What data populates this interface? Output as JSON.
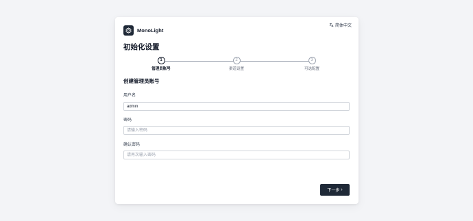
{
  "brand": {
    "name": "MonoLight",
    "logo_icon": "gear-icon"
  },
  "language": {
    "icon": "translate-icon",
    "label": "简体中文"
  },
  "page_title": "初始化设置",
  "steps": [
    {
      "number": "1",
      "label": "管理员账号",
      "active": true
    },
    {
      "number": "2",
      "label": "渠道设置",
      "active": false
    },
    {
      "number": "3",
      "label": "可选配置",
      "active": false
    }
  ],
  "section_title": "创建管理员账号",
  "form": {
    "username": {
      "label": "用户名",
      "value": "admin",
      "placeholder": ""
    },
    "password": {
      "label": "密码",
      "value": "",
      "placeholder": "请输入密码"
    },
    "confirm": {
      "label": "确认密码",
      "value": "",
      "placeholder": "请再次输入密码"
    }
  },
  "next_button": {
    "label": "下一步",
    "icon": "chevron-right-icon"
  },
  "colors": {
    "background": "#f3f4f7",
    "card": "#ffffff",
    "primary": "#1f2937",
    "inactive": "#9ca3af"
  }
}
